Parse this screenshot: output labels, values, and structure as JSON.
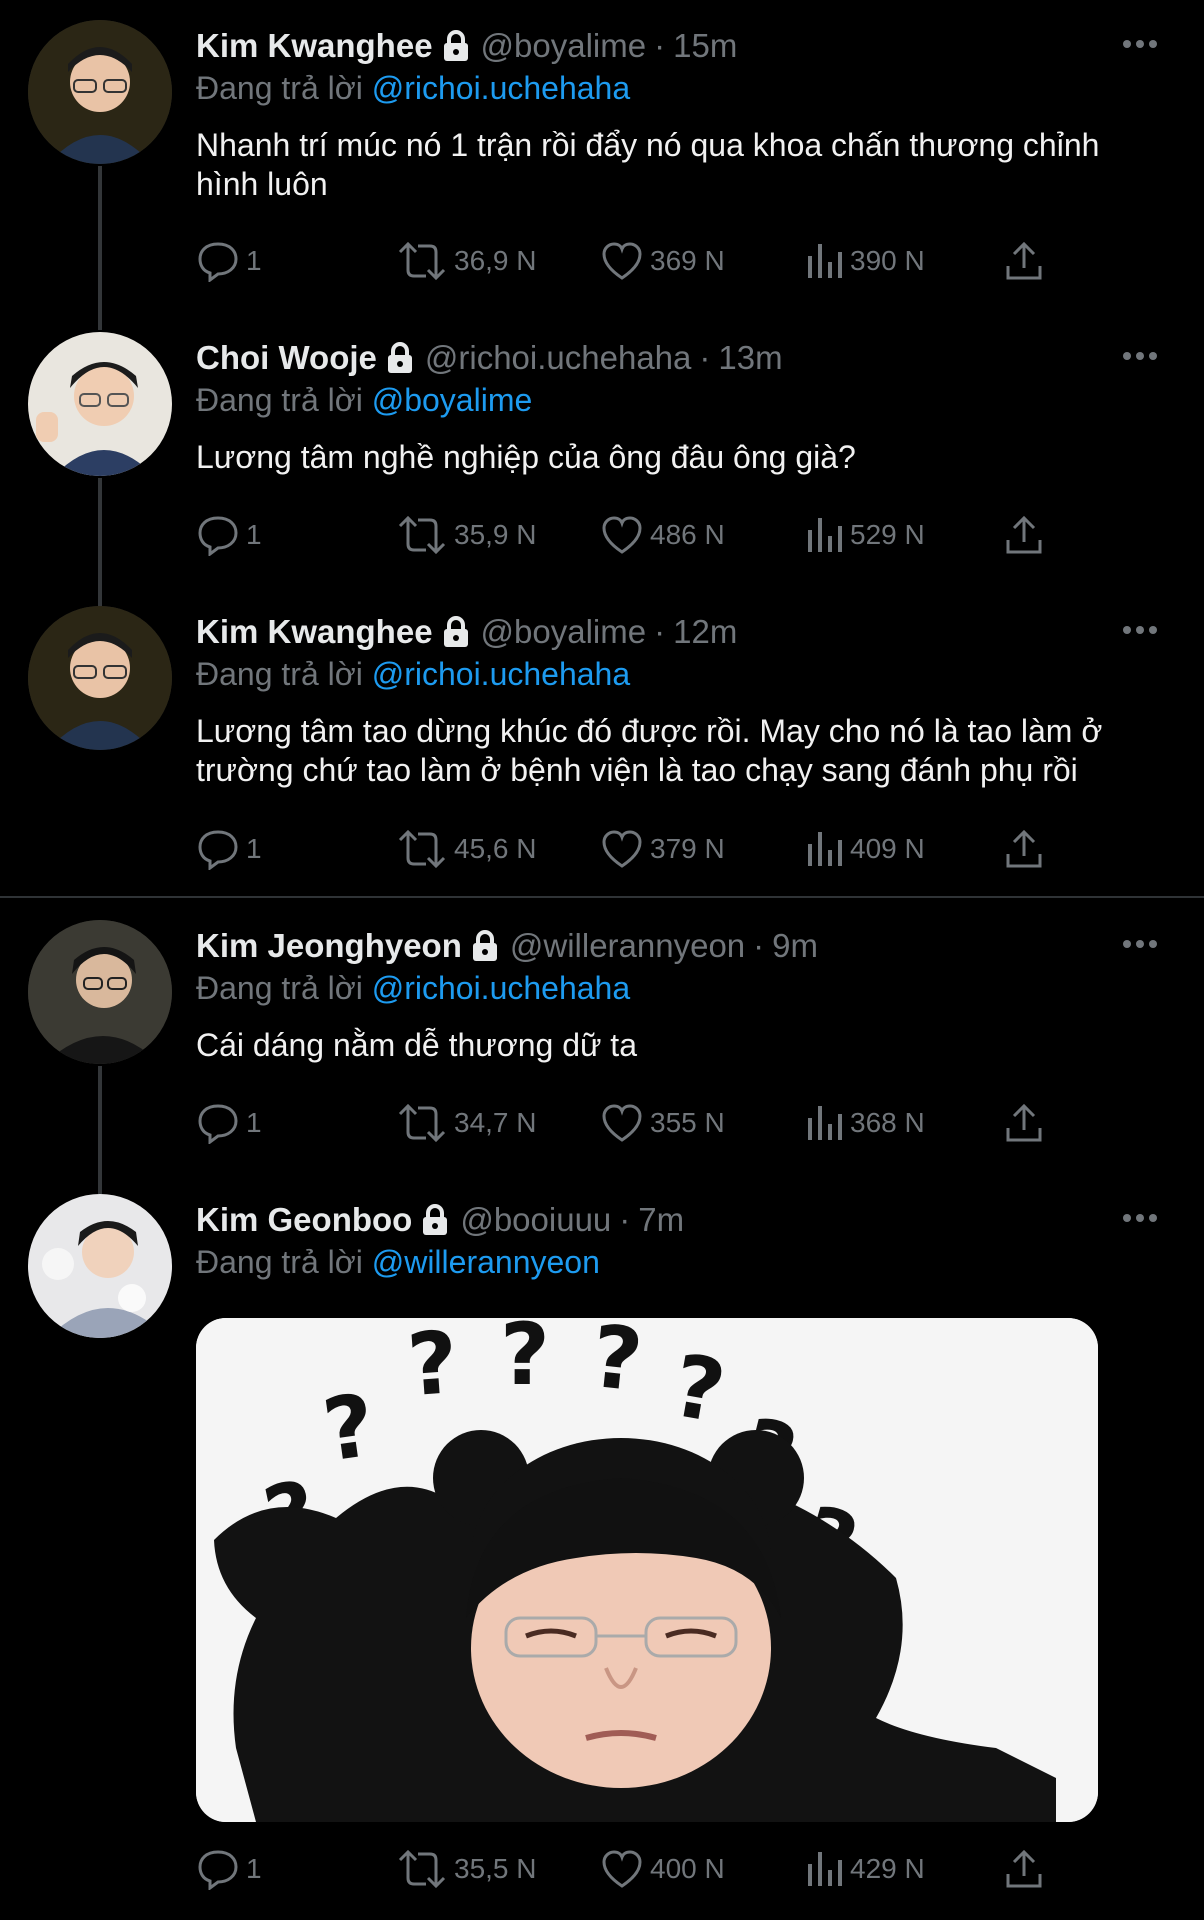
{
  "tweets": [
    {
      "name": "Kim Kwanghee",
      "handle": "@boyalime",
      "time": "15m",
      "replying_prefix": "Đang trả lời",
      "mention": "@richoi.uchehaha",
      "text": "Nhanh trí múc nó 1 trận rồi đẩy nó qua khoa chấn thương chỉnh hình luôn",
      "replies": "1",
      "retweets": "36,9 N",
      "likes": "369 N",
      "views": "390 N"
    },
    {
      "name": "Choi Wooje",
      "handle": "@richoi.uchehaha",
      "time": "13m",
      "replying_prefix": "Đang trả lời",
      "mention": "@boyalime",
      "text": "Lương tâm nghề nghiệp của ông đâu ông già?",
      "replies": "1",
      "retweets": "35,9 N",
      "likes": "486 N",
      "views": "529 N"
    },
    {
      "name": "Kim Kwanghee",
      "handle": "@boyalime",
      "time": "12m",
      "replying_prefix": "Đang trả lời",
      "mention": "@richoi.uchehaha",
      "text": "Lương tâm tao dừng khúc đó được rồi. May cho nó là tao làm ở trường chứ tao làm ở bệnh viện là tao chạy sang đánh phụ rồi",
      "replies": "1",
      "retweets": "45,6 N",
      "likes": "379 N",
      "views": "409 N"
    },
    {
      "name": "Kim Jeonghyeon",
      "handle": "@willerannyeon",
      "time": "9m",
      "replying_prefix": "Đang trả lời",
      "mention": "@richoi.uchehaha",
      "text": "Cái dáng nằm dễ thương dữ ta",
      "replies": "1",
      "retweets": "34,7 N",
      "likes": "355 N",
      "views": "368 N"
    },
    {
      "name": "Kim Geonboo",
      "handle": "@booiuuu",
      "time": "7m",
      "replying_prefix": "Đang trả lời",
      "mention": "@willerannyeon",
      "text": "",
      "replies": "1",
      "retweets": "35,5 N",
      "likes": "400 N",
      "views": "429 N"
    }
  ],
  "separator": "·",
  "icons": [
    "reply-icon",
    "retweet-icon",
    "like-icon",
    "views-icon",
    "share-icon",
    "lock-icon",
    "more-icon"
  ],
  "colors": {
    "background": "#000000",
    "mention": "#1d9bf0",
    "muted": "#71767b",
    "text": "#e7e9ea",
    "thread_line": "#333639"
  }
}
